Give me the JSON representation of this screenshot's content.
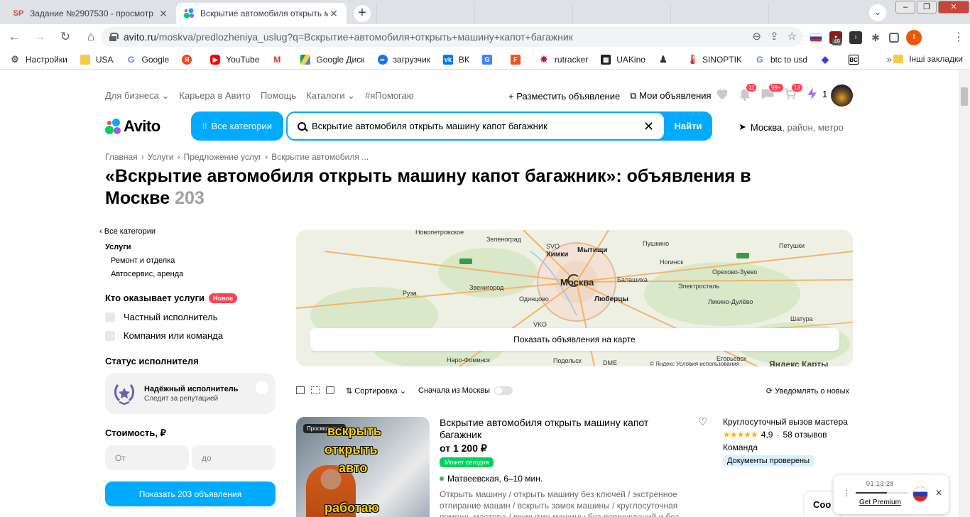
{
  "browser": {
    "tabs": [
      {
        "title": "Задание №2907530 - просмотр",
        "favicon": "SP"
      },
      {
        "title": "Вскрытие автомобиля открыть маш"
      }
    ],
    "url_host": "avito.ru",
    "url_path": "/moskva/predlozheniya_uslug?q=Вскрытие+автомобиля+открыть+машину+капот+багажник",
    "ext_counter": "49",
    "bookmarks": [
      "Настройки",
      "USA",
      "Google",
      "YouTube",
      "Gmail",
      "Google Диск",
      "загрузчик",
      "ВК",
      "Translate",
      "F",
      "rutracker",
      "UAKino",
      "person",
      "SINOPTIK",
      "btc to usd",
      "Ethereum",
      "BC"
    ],
    "bookmark_labels": {
      "settings": "Настройки",
      "usa": "USA",
      "google": "Google",
      "youtube": "YouTube",
      "gdrive": "Google Диск",
      "loader": "загрузчик",
      "vk": "ВК",
      "rutracker": "rutracker",
      "uakino": "UAKino",
      "sinoptik": "SINOPTIK",
      "btc": "btc to usd"
    },
    "other_bookmarks": "Інші закладки"
  },
  "header": {
    "topnav": [
      "Для бизнеса",
      "Карьера в Авито",
      "Помощь",
      "Каталоги",
      "#яПомогаю"
    ],
    "post_ad": "Разместить объявление",
    "my_ads": "Мои объявления",
    "badges": {
      "notifications": "11",
      "messages": "99+",
      "cart": "13"
    },
    "lightning_count": "1",
    "logo": "Avito",
    "all_categories": "Все категории",
    "search_value": "Вскрытие автомобиля открыть машину капот багажник",
    "search_button": "Найти",
    "location_city": "Москва",
    "location_rest": ", район, метро"
  },
  "breadcrumbs": [
    "Главная",
    "Услуги",
    "Предложение услуг",
    "Вскрытие автомобиля ..."
  ],
  "page_title": "«Вскрытие автомобиля открыть машину капот багажник»: объявления в Москве",
  "results_count": "203",
  "sidebar": {
    "back": "Все категории",
    "category": "Услуги",
    "subcategories": [
      "Ремонт и отделка",
      "Автосервис, аренда"
    ],
    "who_title": "Кто оказывает услуги",
    "new_badge": "Новое",
    "who_options": [
      "Частный исполнитель",
      "Компания или команда"
    ],
    "status_title": "Статус исполнителя",
    "reliable_title": "Надёжный исполнитель",
    "reliable_sub": "Следит за репутацией",
    "price_title": "Стоимость, ₽",
    "price_from": "От",
    "price_to": "до",
    "show_button": "Показать 203 объявления"
  },
  "map": {
    "labels": [
      "Новопетровское",
      "Зеленоград",
      "SVO",
      "Мытищи",
      "Химки",
      "Пушкино",
      "Ногинск",
      "Орехово-Зуево",
      "Петушки",
      "Руза",
      "Звенигород",
      "Москва",
      "Балашиха",
      "Электросталь",
      "Одинцово",
      "Люберцы",
      "Ликино-Дулёво",
      "VKO",
      "Шатура",
      "Наро-Фоминск",
      "Подольск",
      "DME",
      "Егорьевск"
    ],
    "show_on_map": "Показать объявления на карте",
    "copyright": "© Яндекс Условия использования",
    "brand": "Яндекс Карты"
  },
  "controls": {
    "sort": "Сортировка",
    "moscow_first": "Сначала из Москвы",
    "notify": "Уведомлять о новых"
  },
  "listing": {
    "viewed": "Просмотрено",
    "image_text": [
      "вскрыть",
      "открыть",
      "авто",
      "работаю"
    ],
    "title": "Вскрытие автомобиля открыть машину капот багажник",
    "price": "от 1 200 ₽",
    "badge": "Может сегодня",
    "location": "Матвеевская, 6–10 мин.",
    "description": "Открыть машину / открыть машину без ключей / экстренное отпирание машин / вскрыть замок машины / круглосуточная помощь мастера / вскрытие машины без повреждений и без",
    "seller_name": "Круглосуточный вызов мастера",
    "rating": "4,9",
    "reviews": "58 отзывов",
    "seller_type": "Команда",
    "docs_badge": "Документы проверены"
  },
  "widgets": {
    "cookie": "Coo",
    "timer": "01:13:28",
    "timer_progress": 0.6,
    "get_premium": "Get Premium"
  },
  "colors": {
    "avito_blue": "#00aaff",
    "badge_red": "#ff4053",
    "today_green": "#02d15c",
    "star_yellow": "#ffb021"
  }
}
